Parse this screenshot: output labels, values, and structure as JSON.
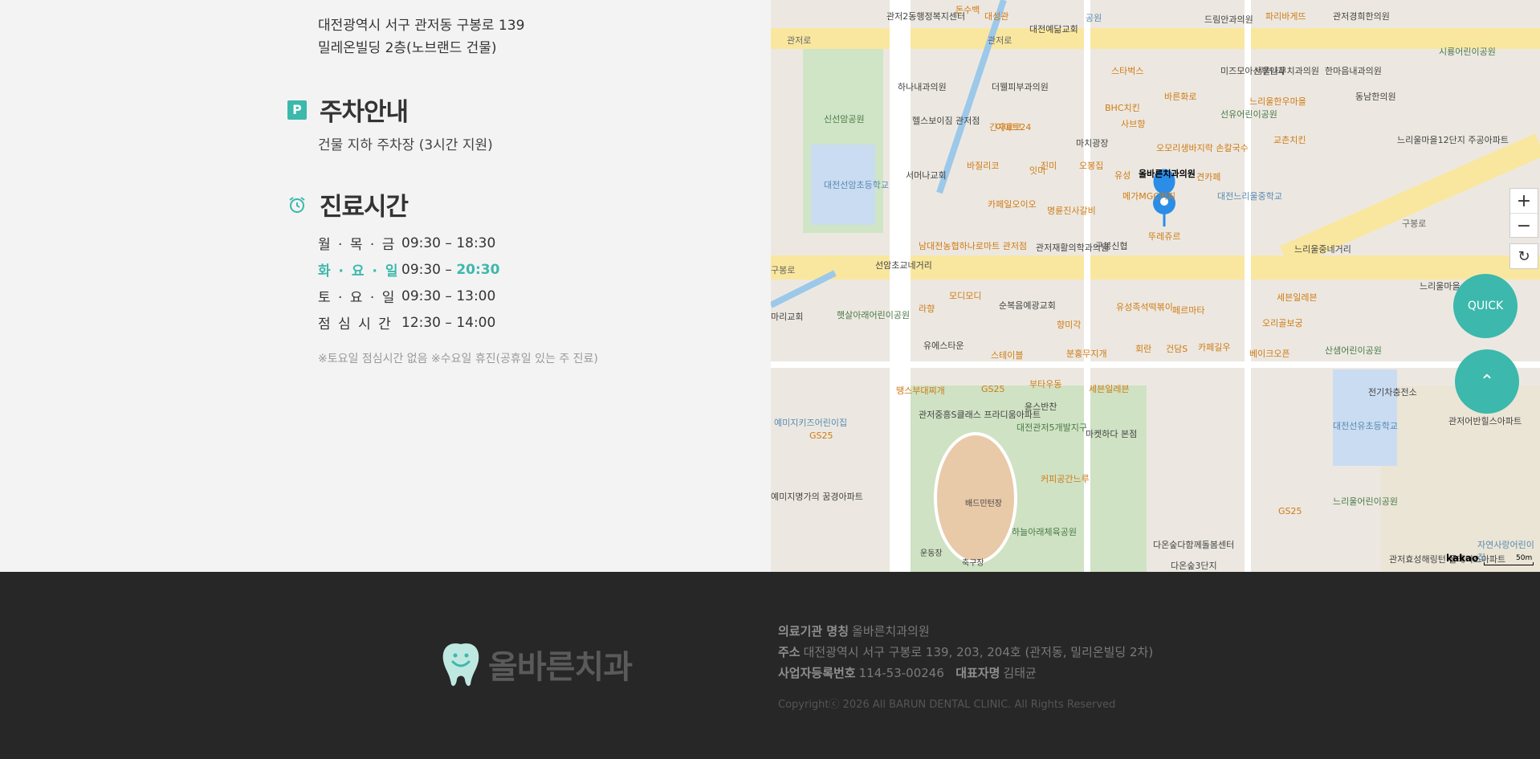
{
  "location": {
    "address_line1": "대전광역시 서구 관저동 구봉로 139",
    "address_line2": "밀레온빌딩 2층(노브랜드 건물)"
  },
  "parking": {
    "icon_letter": "P",
    "title": "주차안내",
    "text": "건물 지하 주차장 (3시간 지원)"
  },
  "hours": {
    "title": "진료시간",
    "rows": [
      {
        "day": "월 · 목 · 금",
        "start": "09:30 –",
        "end": "18:30"
      },
      {
        "day": "화 · 요 · 일",
        "start": "09:30 –",
        "end": "20:30"
      },
      {
        "day": "토 · 요 · 일",
        "start": "09:30 –",
        "end": "13:00"
      },
      {
        "day": "점 심 시 간",
        "start": "12:30 –",
        "end": "14:00"
      }
    ],
    "note": "※토요일 점심시간 없음 ※수요일 휴진(공휴일 있는 주 진료)"
  },
  "map": {
    "marker_label": "올바른치과의원",
    "labels": [
      "관저로",
      "관저로",
      "구봉로",
      "구봉로",
      "공원",
      "대전예닮교회",
      "드림안과의원",
      "관저경희한의원",
      "신선암공원",
      "대전선암초등학교",
      "서머나교회",
      "헬스보이짐 관저점",
      "하나내과의원",
      "더웰피부과의원",
      "마치광장",
      "이마트24",
      "긴자료코",
      "BHC치킨",
      "사브향",
      "바른화로",
      "스타벅스",
      "미즈모아산부인과",
      "서울나무치과의원",
      "선유어린이공원",
      "느리울한우마을",
      "교촌치킨",
      "한마음내과의원",
      "동남한의원",
      "시룡어린이공원",
      "오모리생바지락 손칼국수",
      "견카페",
      "대전느리울중학교",
      "유성",
      "메가MGC커피",
      "뚜레쥬르",
      "구봉신협",
      "관저재활의학과의원",
      "남대전농협하나로마트 관저점",
      "바질리코",
      "카페일오이오",
      "명륜진사갈비",
      "오봉집",
      "잇미",
      "선암초교네거리",
      "느리울중네거리",
      "모디모디",
      "라향",
      "순복음예광교회",
      "향미각",
      "유성족석떡볶이",
      "페르마타",
      "오리골보궁",
      "세븐일레븐",
      "유에스타운",
      "스테이블",
      "분홍무지개",
      "회란",
      "건담S",
      "카페길우",
      "베이크오픈",
      "햇살아래어린이공원",
      "산샘어린이공원",
      "땡스부대찌개",
      "GS25",
      "부타우동",
      "윤스반찬",
      "관저중흥S클래스 프라디움아파트",
      "대전관저5개발지구",
      "마켓하다 본점",
      "예미지키즈어린이집",
      "세븐일레븐",
      "커피공간느루",
      "배드민턴장",
      "하늘아래체육공원",
      "축구장",
      "운동장",
      "예미지명가의 꿈경아파트",
      "다온숲다함께돌봄센터",
      "다온숲3단지",
      "관저효성해링턴 플레이스아파트",
      "자연사랑어린이집",
      "느리울어린이공원",
      "대전선유초등학교",
      "전기차충전소",
      "관저어반힐스아파트",
      "느리울마을12단지 주공아파트",
      "느리울마을 주공아파트",
      "GS25",
      "GS25",
      "마리교회",
      "관저2동행정복지센터",
      "돈수백",
      "대성관",
      "파리바게뜨",
      "진미"
    ],
    "quick_label": "QUICK",
    "zoom_in": "+",
    "zoom_out": "−",
    "refresh": "↻",
    "top_arrow": "⌃",
    "logo": "kakao",
    "scale": "50m"
  },
  "footer": {
    "logo_text": "올바른치과",
    "institution_label": "의료기관 명칭",
    "institution_value": "올바른치과의원",
    "address_label": "주소",
    "address_value": "대전광역시 서구 구봉로 139, 203, 204호 (관저동, 밀리온빌딩 2차)",
    "bizno_label": "사업자등록번호",
    "bizno_value": "114-53-00246",
    "ceo_label": "대표자명",
    "ceo_value": "김태균",
    "copyright": "Copyrightⓒ 2026 All BARUN DENTAL CLINIC. All Rights Reserved"
  },
  "colors": {
    "accent": "#3cb8ac",
    "footer_bg": "#272727",
    "panel_bg": "#f3f3f3"
  }
}
